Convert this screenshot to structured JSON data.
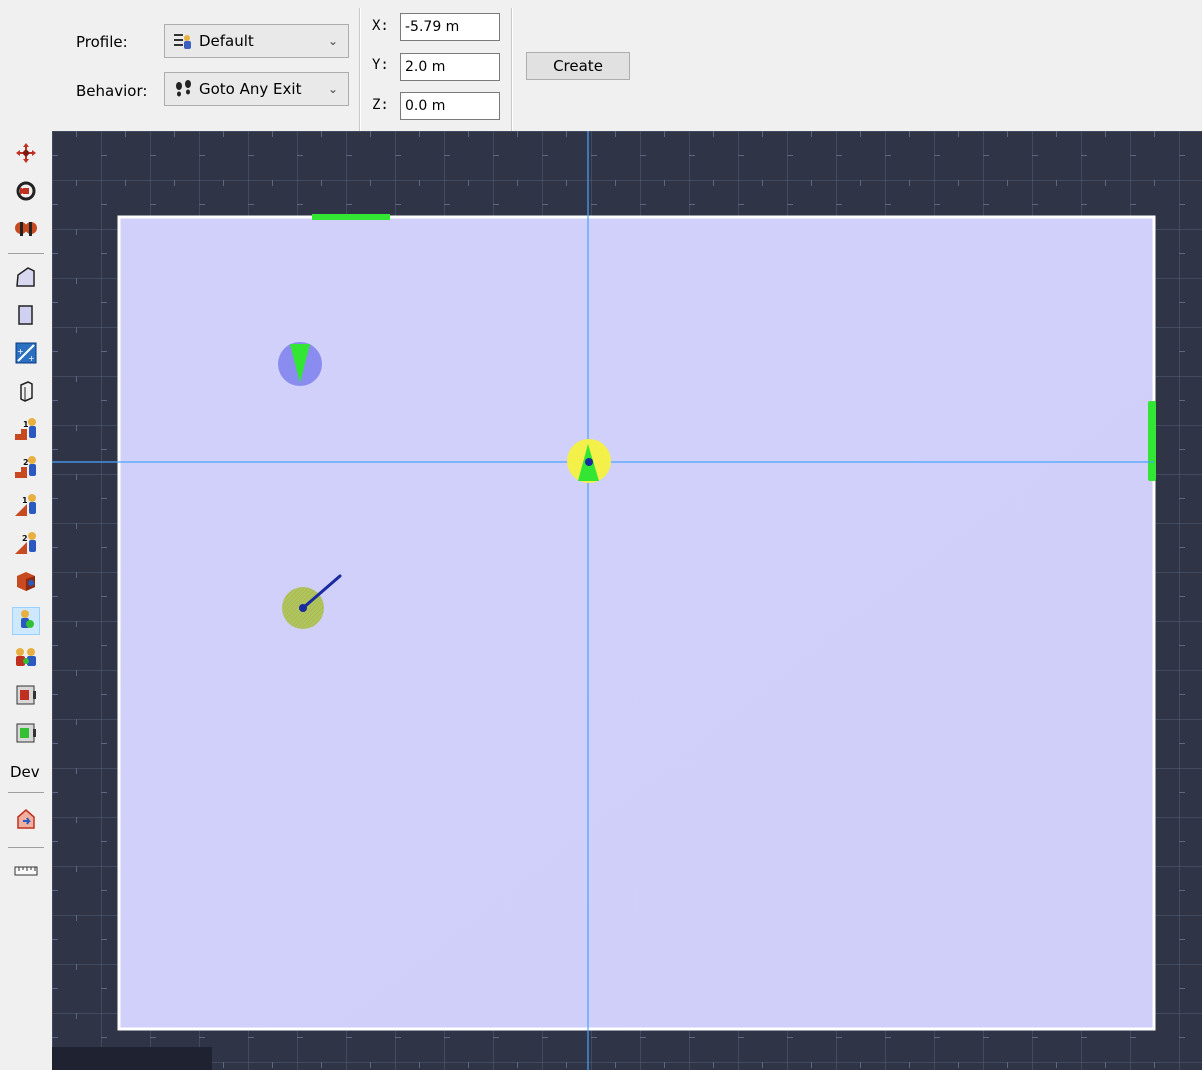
{
  "toolbar": {
    "profile_label": "Profile:",
    "profile_value": "Default",
    "profile_icon": "profile-icon",
    "behavior_label": "Behavior:",
    "behavior_value": "Goto Any Exit",
    "behavior_icon": "footsteps-icon",
    "x_label": "X:",
    "x_value": "-5.79 m",
    "y_label": "Y:",
    "y_value": "2.0 m",
    "z_label": "Z:",
    "z_value": "0.0 m",
    "create_label": "Create"
  },
  "palette": {
    "tools": [
      {
        "name": "move-tool",
        "icon": "move-icon"
      },
      {
        "name": "rotate-tool",
        "icon": "rotate-icon"
      },
      {
        "name": "pan-tool",
        "icon": "pan-icon"
      },
      {
        "name": "polygon-tool",
        "icon": "polygon-icon"
      },
      {
        "name": "rectangle-tool",
        "icon": "rectangle-icon"
      },
      {
        "name": "door-tool",
        "icon": "door-icon"
      },
      {
        "name": "wall-tool",
        "icon": "wall-icon"
      },
      {
        "name": "stair-up-1-tool",
        "icon": "stair-up-1-icon"
      },
      {
        "name": "stair-up-2-tool",
        "icon": "stair-up-2-icon"
      },
      {
        "name": "ramp-1-tool",
        "icon": "ramp-1-icon"
      },
      {
        "name": "ramp-2-tool",
        "icon": "ramp-2-icon"
      },
      {
        "name": "obstruction-tool",
        "icon": "obstruction-icon"
      },
      {
        "name": "occupant-tool",
        "icon": "occupant-icon",
        "selected": true
      },
      {
        "name": "group-tool",
        "icon": "group-icon"
      },
      {
        "name": "exit-red-tool",
        "icon": "exit-red-icon"
      },
      {
        "name": "exit-green-tool",
        "icon": "exit-green-icon"
      }
    ],
    "dev_label": "Dev",
    "dev_tools": [
      {
        "name": "dev-tool",
        "icon": "dev-icon"
      },
      {
        "name": "measure-tool",
        "icon": "ruler-icon"
      }
    ]
  },
  "colors": {
    "grid_bg": "#2f3547",
    "room_fill": "#d0d0fa",
    "exit": "#33e633",
    "crosshair": "#4aa3ff",
    "occupant": "#8a8cf0",
    "selected_occupant": "#f4f04a"
  }
}
